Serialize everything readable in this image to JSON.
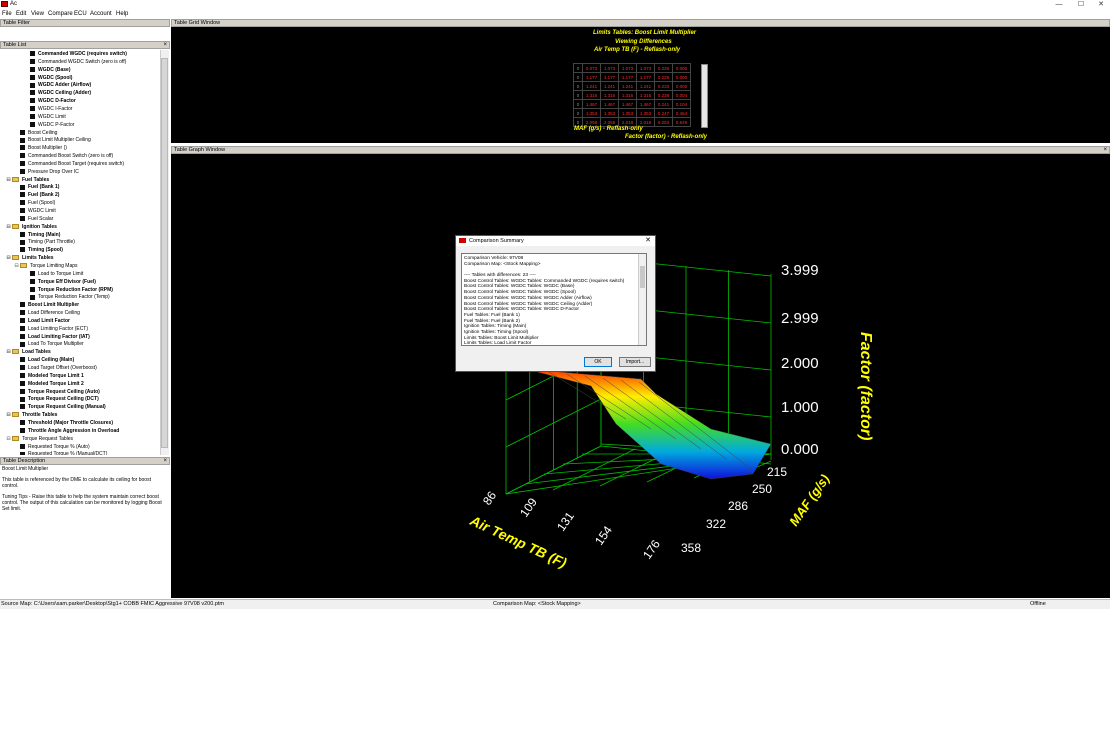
{
  "window": {
    "title": "Ac",
    "controls": [
      "—",
      "☐",
      "✕"
    ]
  },
  "menu": [
    "File",
    "Edit",
    "View",
    "Compare",
    "ECU",
    "Account",
    "Help"
  ],
  "panels": {
    "table_filter": "Table Filter",
    "table_list": "Table List",
    "table_description": "Table Description",
    "grid": "Table Grid Window",
    "graph": "Table Graph Window",
    "close": "×"
  },
  "tree": [
    {
      "label": "Commanded WGDC (requires switch)",
      "bold": true
    },
    {
      "label": "Commanded WGDC Switch (zero is off)",
      "bold": false
    },
    {
      "label": "WGDC (Base)",
      "bold": true
    },
    {
      "label": "WGDC (Spool)",
      "bold": true
    },
    {
      "label": "WGDC Adder (Airflow)",
      "bold": true
    },
    {
      "label": "WGDC Ceiling (Adder)",
      "bold": true
    },
    {
      "label": "WGDC D-Factor",
      "bold": true
    },
    {
      "label": "WGDC I-Factor",
      "bold": false
    },
    {
      "label": "WGDC Limit",
      "bold": false
    },
    {
      "label": "WGDC P-Factor",
      "bold": false
    },
    {
      "label": "Boost Ceiling",
      "bold": false
    },
    {
      "label": "Boost Limit Multiplier Ceiling",
      "bold": false
    },
    {
      "label": "Boost Multiplier ()",
      "bold": false
    },
    {
      "label": "Commanded Boost Switch (zero is off)",
      "bold": false
    },
    {
      "label": "Commanded Boost Target (requires switch)",
      "bold": false
    },
    {
      "label": "Pressure Drop Over IC",
      "bold": false
    },
    {
      "label": "Fuel Tables",
      "bold": true
    },
    {
      "label": "Fuel (Bank 1)",
      "bold": true
    },
    {
      "label": "Fuel (Bank 2)",
      "bold": true
    },
    {
      "label": "Fuel (Spool)",
      "bold": false
    },
    {
      "label": "WGDC Limit",
      "bold": false
    },
    {
      "label": "Fuel Scalar",
      "bold": false
    },
    {
      "label": "Ignition Tables",
      "bold": true
    },
    {
      "label": "Timing (Main)",
      "bold": true
    },
    {
      "label": "Timing (Part Throttle)",
      "bold": false
    },
    {
      "label": "Timing (Spool)",
      "bold": true
    },
    {
      "label": "Limits Tables",
      "bold": true
    },
    {
      "label": "Torque Limiting Maps",
      "bold": false
    },
    {
      "label": "Load to Torque Limit",
      "bold": false
    },
    {
      "label": "Torque Eff Divisor (Fuel)",
      "bold": true
    },
    {
      "label": "Torque Reduction Factor (RPM)",
      "bold": true
    },
    {
      "label": "Torque Reduction Factor (Temp)",
      "bold": false
    },
    {
      "label": "Boost Limit Multiplier",
      "bold": true
    },
    {
      "label": "Load Difference Ceiling",
      "bold": false
    },
    {
      "label": "Load Limit Factor",
      "bold": true
    },
    {
      "label": "Load Limiting Factor (ECT)",
      "bold": false
    },
    {
      "label": "Load Limiting Factor (IAT)",
      "bold": true
    },
    {
      "label": "Load To Torque Multiplier",
      "bold": false
    },
    {
      "label": "Load Tables",
      "bold": true
    },
    {
      "label": "Load Ceiling (Main)",
      "bold": true
    },
    {
      "label": "Load Target Offset (Overboost)",
      "bold": false
    },
    {
      "label": "Modeled Torque Limit 1",
      "bold": true
    },
    {
      "label": "Modeled Torque Limit 2",
      "bold": true
    },
    {
      "label": "Torque Request Ceiling (Auto)",
      "bold": true
    },
    {
      "label": "Torque Request Ceiling (DCT)",
      "bold": true
    },
    {
      "label": "Torque Request Ceiling (Manual)",
      "bold": true
    },
    {
      "label": "Throttle Tables",
      "bold": true
    },
    {
      "label": "Threshold (Major Throttle Closures)",
      "bold": true
    },
    {
      "label": "Throttle Angle Aggression in Overload",
      "bold": true
    },
    {
      "label": "Torque Request Tables",
      "bold": false
    },
    {
      "label": "Requested Torque % (Auto)",
      "bold": false
    },
    {
      "label": "Requested Torque % (Manual/DCT)",
      "bold": false
    }
  ],
  "description": {
    "title": "Boost Limit Multiplier",
    "line1": "This table is referenced by the DME to calculate its ceiling for boost control.",
    "line2": "Tuning Tips - Raise this table to help the system maintain correct boost control. The output of this calculation can be monitored by logging Boost Set limit."
  },
  "grid": {
    "title1": "Limits Tables: Boost Limit Multiplier",
    "title2": "Viewing Differences",
    "title3": "Air Temp TB (F) - Reflash-only",
    "row_axis": "MAF (g/s) - Reflash-only",
    "col_axis": "Factor (factor) - Reflash-only",
    "rows": [
      [
        "0",
        "0.073",
        "1.073",
        "1.073",
        "1.073",
        "0.226",
        "0.000"
      ],
      [
        "0",
        "1.177",
        "1.177",
        "1.177",
        "1.177",
        "0.229",
        "0.000"
      ],
      [
        "0",
        "1.241",
        "1.241",
        "1.241",
        "1.241",
        "0.233",
        "0.000"
      ],
      [
        "0",
        "1.316",
        "1.316",
        "1.316",
        "1.316",
        "0.238",
        "0.004"
      ],
      [
        "0",
        "1.467",
        "1.467",
        "1.467",
        "1.467",
        "0.241",
        "0.104"
      ],
      [
        "0",
        "1.353",
        "1.353",
        "1.353",
        "1.353",
        "0.247",
        "0.464"
      ],
      [
        "0",
        "2.058",
        "2.058",
        "2.018",
        "2.018",
        "0.253",
        "0.549"
      ]
    ]
  },
  "chart_data": {
    "type": "surface3d",
    "zlabel": "Factor (factor)",
    "xlabel": "Air Temp TB (F)",
    "ylabel": "MAF (g/s)",
    "z_ticks": [
      "3.999",
      "2.999",
      "2.000",
      "1.000",
      "0.000"
    ],
    "x_ticks": [
      "86",
      "109",
      "131",
      "154",
      "176"
    ],
    "y_ticks": [
      "215",
      "250",
      "286",
      "322",
      "358"
    ],
    "zlim": [
      0,
      4
    ],
    "colors": {
      "axis_label": "#ffff00",
      "grid": "#00c000",
      "tick": "#ffffff"
    }
  },
  "dialog": {
    "title": "Comparison Summary",
    "lines": [
      "Comparison Vehicle: 97V08",
      "Comparison Map: <Stock Mapping>",
      "",
      "---- Tables with differences: 23 ----",
      "Boost Control Tables: WGDC Tables: Commanded WGDC (requires switch)",
      "Boost Control Tables: WGDC Tables: WGDC (Base)",
      "Boost Control Tables: WGDC Tables: WGDC (Spool)",
      "Boost Control Tables: WGDC Tables: WGDC Adder (Airflow)",
      "Boost Control Tables: WGDC Tables: WGDC Ceiling (Adder)",
      "Boost Control Tables: WGDC Tables: WGDC D-Factor",
      "Fuel Tables: Fuel (Bank 1)",
      "Fuel Tables: Fuel (Bank 2)",
      "Ignition Tables: Timing (Main)",
      "Ignition Tables: Timing (Spool)",
      "Limits Tables: Boost Limit Multiplier",
      "Limits Tables: Load Limit Factor"
    ],
    "ok": "OK",
    "import": "Import...",
    "close": "✕"
  },
  "status": {
    "source": "Source Map: C:\\Users\\sam.parker\\Desktop\\Stg1+ COBB FMIC Aggressive 97V08 v200.ptm",
    "comparison": "Comparison Map: <Stock Mapping>",
    "mode": "Offline"
  }
}
